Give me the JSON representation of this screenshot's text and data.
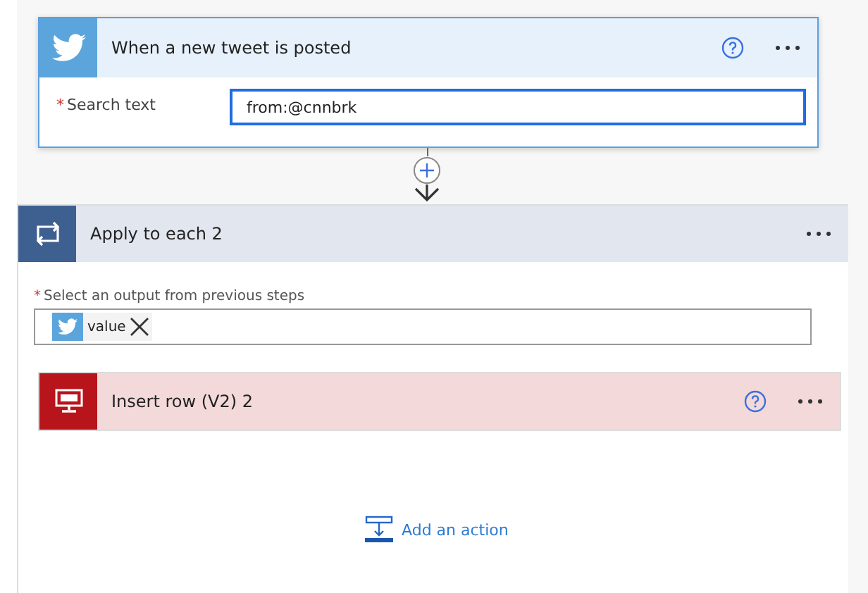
{
  "trigger": {
    "title": "When a new tweet is posted",
    "field": {
      "required_mark": "*",
      "label": "Search text",
      "value": "from:@cnnbrk"
    }
  },
  "loop": {
    "title": "Apply to each 2",
    "field": {
      "required_mark": "*",
      "label": "Select an output from previous steps",
      "tokens": [
        {
          "label": "value"
        }
      ]
    },
    "actions": [
      {
        "title": "Insert row (V2) 2"
      }
    ]
  },
  "add_action": "Add an action"
}
